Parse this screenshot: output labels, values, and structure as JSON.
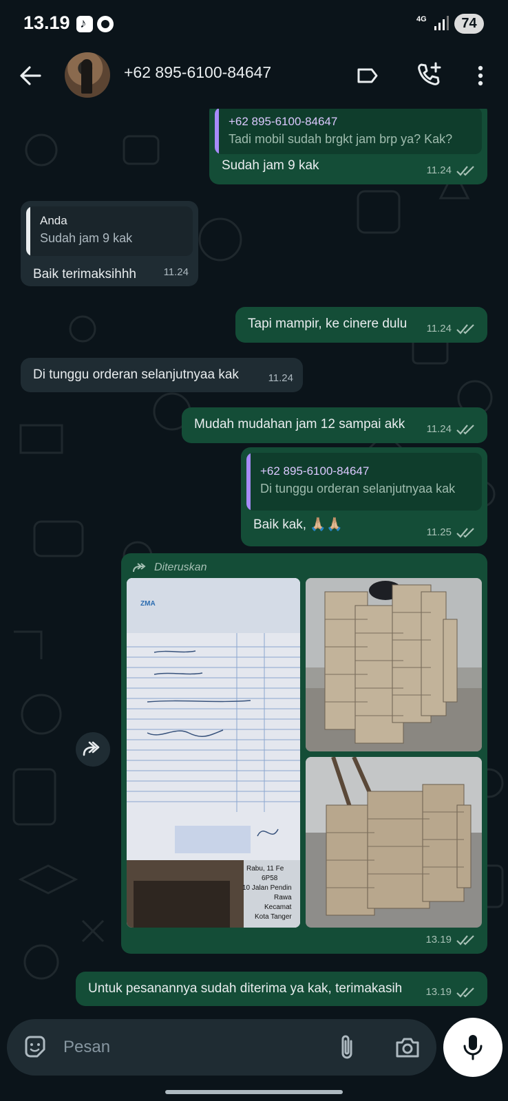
{
  "status_bar": {
    "time": "13.19",
    "network": "4G",
    "battery": "74"
  },
  "header": {
    "contact": "+62 895-6100-84647",
    "icons": [
      "back-arrow-icon",
      "label-icon",
      "add-call-icon",
      "more-vert-icon"
    ]
  },
  "messages": [
    {
      "dir": "out",
      "quote_name": "+62 895-6100-84647",
      "quote_text": "Tadi mobil sudah brgkt jam brp ya? Kak?",
      "text": "Sudah jam 9 kak",
      "time": "11.24",
      "status": "read"
    },
    {
      "dir": "in",
      "quote_name": "Anda",
      "quote_text": "Sudah jam 9 kak",
      "text": "Baik terimaksihhh",
      "time": "11.24"
    },
    {
      "dir": "out",
      "text": "Tapi mampir, ke cinere dulu",
      "time": "11.24",
      "status": "read"
    },
    {
      "dir": "in",
      "text": "Di tunggu orderan selanjutnyaa kak",
      "time": "11.24"
    },
    {
      "dir": "out",
      "text": "Mudah mudahan jam 12 sampai akk",
      "time": "11.24",
      "status": "read"
    },
    {
      "dir": "out",
      "quote_name": "+62 895-6100-84647",
      "quote_text": "Di tunggu orderan selanjutnyaa kak",
      "text": "Baik kak, 🙏🏼🙏🏼",
      "time": "11.25",
      "status": "read"
    },
    {
      "dir": "out",
      "forwarded_label": "Diteruskan",
      "photos": [
        "receipt-photo",
        "tiles-stack-photo-1",
        "tiles-stack-photo-2"
      ],
      "time": "13.19",
      "status": "read"
    },
    {
      "dir": "out",
      "text": "Untuk pesanannya sudah diterima ya kak, terimakasih",
      "time": "13.19",
      "status": "read"
    }
  ],
  "input": {
    "placeholder": "Pesan"
  },
  "colors": {
    "outgoing": "#144d37",
    "incoming": "#1f2c33",
    "background": "#0b141a",
    "quote_green": "#06cf9c",
    "quote_purple": "#a78bfa"
  }
}
